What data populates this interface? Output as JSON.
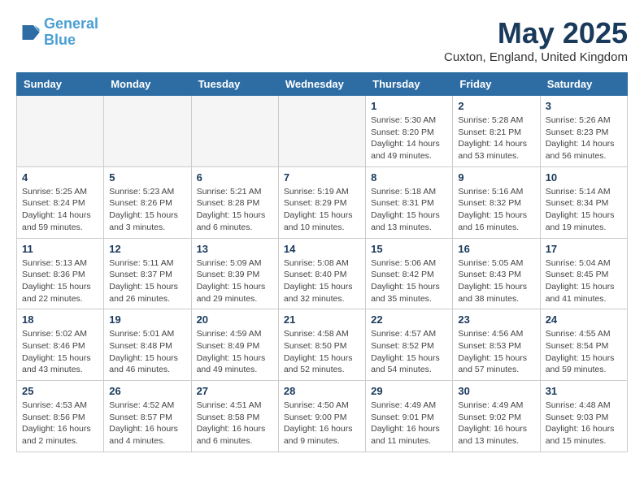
{
  "header": {
    "logo_line1": "General",
    "logo_line2": "Blue",
    "month_title": "May 2025",
    "location": "Cuxton, England, United Kingdom"
  },
  "weekdays": [
    "Sunday",
    "Monday",
    "Tuesday",
    "Wednesday",
    "Thursday",
    "Friday",
    "Saturday"
  ],
  "weeks": [
    [
      {
        "day": "",
        "info": ""
      },
      {
        "day": "",
        "info": ""
      },
      {
        "day": "",
        "info": ""
      },
      {
        "day": "",
        "info": ""
      },
      {
        "day": "1",
        "info": "Sunrise: 5:30 AM\nSunset: 8:20 PM\nDaylight: 14 hours\nand 49 minutes."
      },
      {
        "day": "2",
        "info": "Sunrise: 5:28 AM\nSunset: 8:21 PM\nDaylight: 14 hours\nand 53 minutes."
      },
      {
        "day": "3",
        "info": "Sunrise: 5:26 AM\nSunset: 8:23 PM\nDaylight: 14 hours\nand 56 minutes."
      }
    ],
    [
      {
        "day": "4",
        "info": "Sunrise: 5:25 AM\nSunset: 8:24 PM\nDaylight: 14 hours\nand 59 minutes."
      },
      {
        "day": "5",
        "info": "Sunrise: 5:23 AM\nSunset: 8:26 PM\nDaylight: 15 hours\nand 3 minutes."
      },
      {
        "day": "6",
        "info": "Sunrise: 5:21 AM\nSunset: 8:28 PM\nDaylight: 15 hours\nand 6 minutes."
      },
      {
        "day": "7",
        "info": "Sunrise: 5:19 AM\nSunset: 8:29 PM\nDaylight: 15 hours\nand 10 minutes."
      },
      {
        "day": "8",
        "info": "Sunrise: 5:18 AM\nSunset: 8:31 PM\nDaylight: 15 hours\nand 13 minutes."
      },
      {
        "day": "9",
        "info": "Sunrise: 5:16 AM\nSunset: 8:32 PM\nDaylight: 15 hours\nand 16 minutes."
      },
      {
        "day": "10",
        "info": "Sunrise: 5:14 AM\nSunset: 8:34 PM\nDaylight: 15 hours\nand 19 minutes."
      }
    ],
    [
      {
        "day": "11",
        "info": "Sunrise: 5:13 AM\nSunset: 8:36 PM\nDaylight: 15 hours\nand 22 minutes."
      },
      {
        "day": "12",
        "info": "Sunrise: 5:11 AM\nSunset: 8:37 PM\nDaylight: 15 hours\nand 26 minutes."
      },
      {
        "day": "13",
        "info": "Sunrise: 5:09 AM\nSunset: 8:39 PM\nDaylight: 15 hours\nand 29 minutes."
      },
      {
        "day": "14",
        "info": "Sunrise: 5:08 AM\nSunset: 8:40 PM\nDaylight: 15 hours\nand 32 minutes."
      },
      {
        "day": "15",
        "info": "Sunrise: 5:06 AM\nSunset: 8:42 PM\nDaylight: 15 hours\nand 35 minutes."
      },
      {
        "day": "16",
        "info": "Sunrise: 5:05 AM\nSunset: 8:43 PM\nDaylight: 15 hours\nand 38 minutes."
      },
      {
        "day": "17",
        "info": "Sunrise: 5:04 AM\nSunset: 8:45 PM\nDaylight: 15 hours\nand 41 minutes."
      }
    ],
    [
      {
        "day": "18",
        "info": "Sunrise: 5:02 AM\nSunset: 8:46 PM\nDaylight: 15 hours\nand 43 minutes."
      },
      {
        "day": "19",
        "info": "Sunrise: 5:01 AM\nSunset: 8:48 PM\nDaylight: 15 hours\nand 46 minutes."
      },
      {
        "day": "20",
        "info": "Sunrise: 4:59 AM\nSunset: 8:49 PM\nDaylight: 15 hours\nand 49 minutes."
      },
      {
        "day": "21",
        "info": "Sunrise: 4:58 AM\nSunset: 8:50 PM\nDaylight: 15 hours\nand 52 minutes."
      },
      {
        "day": "22",
        "info": "Sunrise: 4:57 AM\nSunset: 8:52 PM\nDaylight: 15 hours\nand 54 minutes."
      },
      {
        "day": "23",
        "info": "Sunrise: 4:56 AM\nSunset: 8:53 PM\nDaylight: 15 hours\nand 57 minutes."
      },
      {
        "day": "24",
        "info": "Sunrise: 4:55 AM\nSunset: 8:54 PM\nDaylight: 15 hours\nand 59 minutes."
      }
    ],
    [
      {
        "day": "25",
        "info": "Sunrise: 4:53 AM\nSunset: 8:56 PM\nDaylight: 16 hours\nand 2 minutes."
      },
      {
        "day": "26",
        "info": "Sunrise: 4:52 AM\nSunset: 8:57 PM\nDaylight: 16 hours\nand 4 minutes."
      },
      {
        "day": "27",
        "info": "Sunrise: 4:51 AM\nSunset: 8:58 PM\nDaylight: 16 hours\nand 6 minutes."
      },
      {
        "day": "28",
        "info": "Sunrise: 4:50 AM\nSunset: 9:00 PM\nDaylight: 16 hours\nand 9 minutes."
      },
      {
        "day": "29",
        "info": "Sunrise: 4:49 AM\nSunset: 9:01 PM\nDaylight: 16 hours\nand 11 minutes."
      },
      {
        "day": "30",
        "info": "Sunrise: 4:49 AM\nSunset: 9:02 PM\nDaylight: 16 hours\nand 13 minutes."
      },
      {
        "day": "31",
        "info": "Sunrise: 4:48 AM\nSunset: 9:03 PM\nDaylight: 16 hours\nand 15 minutes."
      }
    ]
  ]
}
